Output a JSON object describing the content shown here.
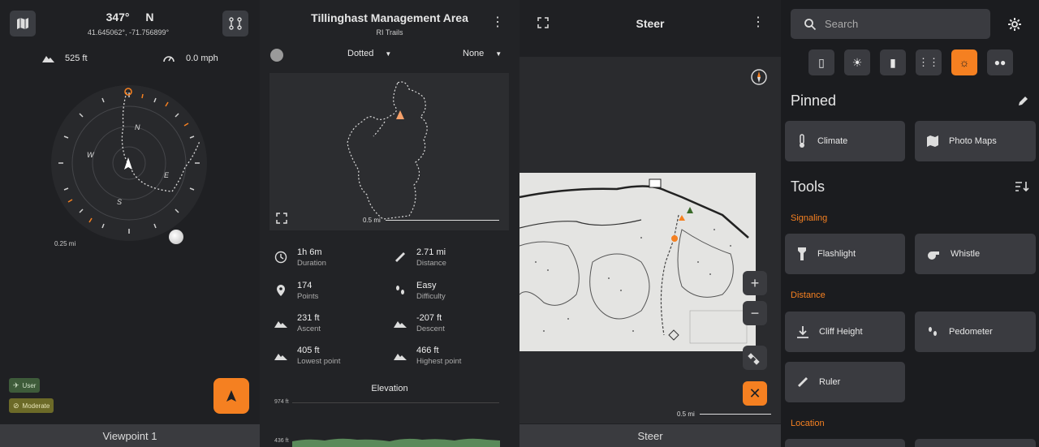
{
  "panel1": {
    "heading": "347°",
    "direction": "N",
    "coords": "41.645062°, -71.756899°",
    "altitude": "525 ft",
    "speed": "0.0 mph",
    "scale": "0.25 mi",
    "compass_labels": {
      "n": "N",
      "e": "E",
      "s": "S",
      "w": "W"
    },
    "badge_user": "User",
    "badge_moderate": "Moderate",
    "bottom": "Viewpoint 1"
  },
  "panel2": {
    "title": "Tillinghast Management Area",
    "subtitle": "RI Trails",
    "line_style": "Dotted",
    "point_style": "None",
    "scale": "0.5 mi",
    "stats": [
      {
        "value": "1h 6m",
        "label": "Duration"
      },
      {
        "value": "2.71 mi",
        "label": "Distance"
      },
      {
        "value": "174",
        "label": "Points"
      },
      {
        "value": "Easy",
        "label": "Difficulty"
      },
      {
        "value": "231 ft",
        "label": "Ascent"
      },
      {
        "value": "-207 ft",
        "label": "Descent"
      },
      {
        "value": "405 ft",
        "label": "Lowest point"
      },
      {
        "value": "466 ft",
        "label": "Highest point"
      }
    ],
    "elevation_title": "Elevation",
    "elev_top": "974 ft",
    "elev_bottom": "436 ft"
  },
  "panel3": {
    "title": "Steer",
    "scale": "0.5 mi",
    "bottom": "Steer",
    "zoom_in": "+",
    "zoom_out": "−",
    "close": "✕"
  },
  "panel4": {
    "search_placeholder": "Search",
    "pinned": "Pinned",
    "tools": "Tools",
    "pinned_items": {
      "climate": "Climate",
      "photo_maps": "Photo Maps"
    },
    "cat_signaling": "Signaling",
    "cat_distance": "Distance",
    "cat_location": "Location",
    "tool_items": {
      "flashlight": "Flashlight",
      "whistle": "Whistle",
      "cliff": "Cliff Height",
      "pedometer": "Pedometer",
      "ruler": "Ruler"
    }
  },
  "colors": {
    "accent": "#f58021",
    "panel": "#3a3b40"
  }
}
